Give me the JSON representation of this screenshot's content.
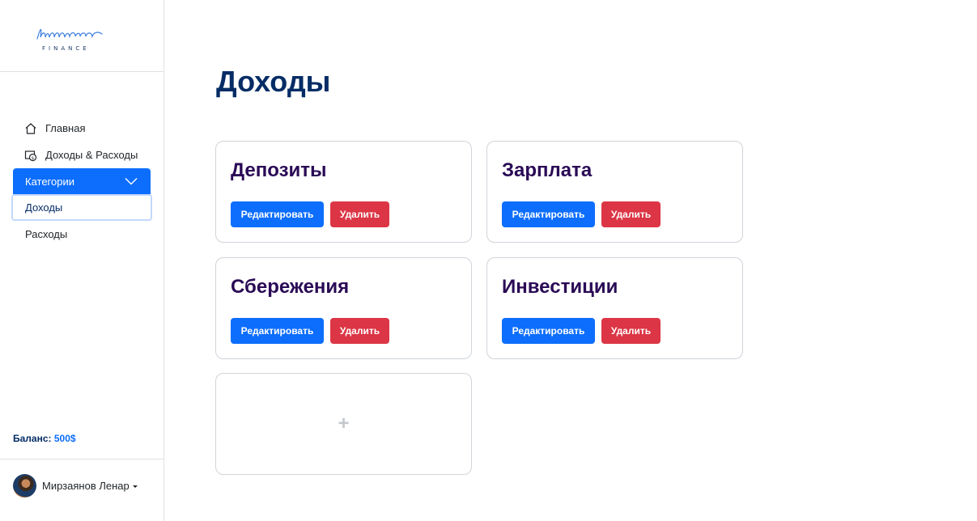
{
  "app": {
    "logo_script": "Luminous",
    "logo_sub": "FINANCE"
  },
  "sidebar": {
    "items": [
      {
        "label": "Главная",
        "icon": "home-icon"
      },
      {
        "label": "Доходы & Расходы",
        "icon": "money-transfer-icon"
      }
    ],
    "dropdown": {
      "label": "Категории",
      "icon": "chevron-down-icon"
    },
    "subitems": [
      {
        "label": "Доходы",
        "active": true
      },
      {
        "label": "Расходы",
        "active": false
      }
    ],
    "balance_label": "Баланс:",
    "balance_value": "500$",
    "user_name": "Мирзаянов Ленар"
  },
  "main": {
    "title": "Доходы",
    "cards": [
      {
        "title": "Депозиты",
        "edit_label": "Редактировать",
        "delete_label": "Удалить"
      },
      {
        "title": "Зарплата",
        "edit_label": "Редактировать",
        "delete_label": "Удалить"
      },
      {
        "title": "Сбережения",
        "edit_label": "Редактировать",
        "delete_label": "Удалить"
      },
      {
        "title": "Инвестиции",
        "edit_label": "Редактировать",
        "delete_label": "Удалить"
      }
    ],
    "add_symbol": "+"
  },
  "colors": {
    "primary": "#0d6efd",
    "danger": "#dc3545",
    "title": "#052c65",
    "card_title": "#2a0a56"
  }
}
